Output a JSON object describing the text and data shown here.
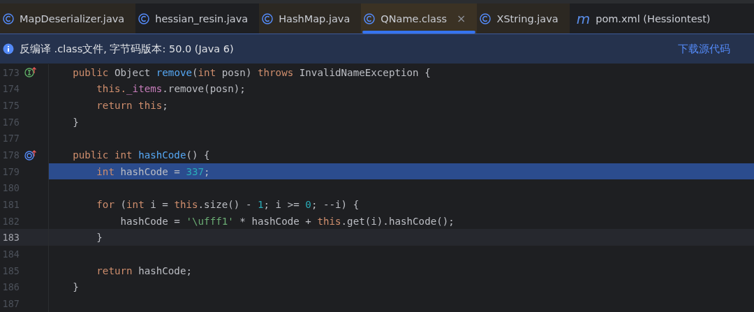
{
  "tabs": [
    {
      "label": "MapDeserializer.java",
      "kind": "class",
      "tinted": true,
      "selected": false
    },
    {
      "label": "hessian_resin.java",
      "kind": "class",
      "tinted": false,
      "selected": false
    },
    {
      "label": "HashMap.java",
      "kind": "class",
      "tinted": true,
      "selected": false
    },
    {
      "label": "QName.class",
      "kind": "class",
      "tinted": true,
      "selected": true,
      "close": "×"
    },
    {
      "label": "XString.java",
      "kind": "class",
      "tinted": true,
      "selected": false
    },
    {
      "label": "pom.xml (Hessiontest)",
      "kind": "maven",
      "glyph": "m",
      "tinted": false,
      "selected": false
    }
  ],
  "banner": {
    "text": "反编译 .class文件, 字节码版本: 50.0 (Java 6)",
    "link": "下载源代码"
  },
  "lines": [
    {
      "number": "173",
      "gutter": {
        "kind": "implements"
      },
      "selected": false,
      "current": false,
      "tokens": [
        {
          "t": "    public ",
          "kind": "kw"
        },
        {
          "t": "Object ",
          "kind": "plain"
        },
        {
          "t": "remove",
          "kind": "method"
        },
        {
          "t": "(",
          "kind": "plain"
        },
        {
          "t": "int ",
          "kind": "kw"
        },
        {
          "t": "posn) ",
          "kind": "plain"
        },
        {
          "t": "throws ",
          "kind": "kw"
        },
        {
          "t": "InvalidNameException {",
          "kind": "plain"
        }
      ]
    },
    {
      "number": "174",
      "selected": false,
      "current": false,
      "tokens": [
        {
          "t": "        this.",
          "kind": "kw"
        },
        {
          "t": "_items",
          "kind": "field"
        },
        {
          "t": ".remove(posn);",
          "kind": "plain"
        }
      ]
    },
    {
      "number": "175",
      "selected": false,
      "current": false,
      "tokens": [
        {
          "t": "        return this",
          "kind": "kw"
        },
        {
          "t": ";",
          "kind": "plain"
        }
      ]
    },
    {
      "number": "176",
      "selected": false,
      "current": false,
      "tokens": [
        {
          "t": "    }",
          "kind": "plain"
        }
      ]
    },
    {
      "number": "177",
      "selected": false,
      "current": false
    },
    {
      "number": "178",
      "gutter": {
        "kind": "overrides"
      },
      "selected": false,
      "current": false,
      "tokens": [
        {
          "t": "    public int ",
          "kind": "kw"
        },
        {
          "t": "hashCode",
          "kind": "method"
        },
        {
          "t": "() {",
          "kind": "plain"
        }
      ]
    },
    {
      "number": "179",
      "selected": true,
      "current": false,
      "tokens": [
        {
          "t": "        int ",
          "kind": "kw"
        },
        {
          "t": "hashCode = ",
          "kind": "plain"
        },
        {
          "t": "337",
          "kind": "number"
        },
        {
          "t": ";",
          "kind": "plain"
        }
      ]
    },
    {
      "number": "180",
      "selected": false,
      "current": false
    },
    {
      "number": "181",
      "selected": false,
      "current": false,
      "tokens": [
        {
          "t": "        for ",
          "kind": "kw"
        },
        {
          "t": "(",
          "kind": "plain"
        },
        {
          "t": "int ",
          "kind": "kw"
        },
        {
          "t": "i = ",
          "kind": "plain"
        },
        {
          "t": "this",
          "kind": "kw"
        },
        {
          "t": ".size() - ",
          "kind": "plain"
        },
        {
          "t": "1",
          "kind": "number"
        },
        {
          "t": "; i >= ",
          "kind": "plain"
        },
        {
          "t": "0",
          "kind": "number"
        },
        {
          "t": "; --i) {",
          "kind": "plain"
        }
      ]
    },
    {
      "number": "182",
      "selected": false,
      "current": false,
      "tokens": [
        {
          "t": "            hashCode = ",
          "kind": "plain"
        },
        {
          "t": "'\\ufff1'",
          "kind": "string"
        },
        {
          "t": " * hashCode + ",
          "kind": "plain"
        },
        {
          "t": "this",
          "kind": "kw"
        },
        {
          "t": ".get(i).hashCode();",
          "kind": "plain"
        }
      ]
    },
    {
      "number": "183",
      "selected": false,
      "current": true,
      "tokens": [
        {
          "t": "        }",
          "kind": "plain"
        }
      ]
    },
    {
      "number": "184",
      "selected": false,
      "current": false
    },
    {
      "number": "185",
      "selected": false,
      "current": false,
      "tokens": [
        {
          "t": "        return ",
          "kind": "kw"
        },
        {
          "t": "hashCode;",
          "kind": "plain"
        }
      ]
    },
    {
      "number": "186",
      "selected": false,
      "current": false,
      "tokens": [
        {
          "t": "    }",
          "kind": "plain"
        }
      ]
    },
    {
      "number": "187",
      "selected": false,
      "current": false
    }
  ]
}
